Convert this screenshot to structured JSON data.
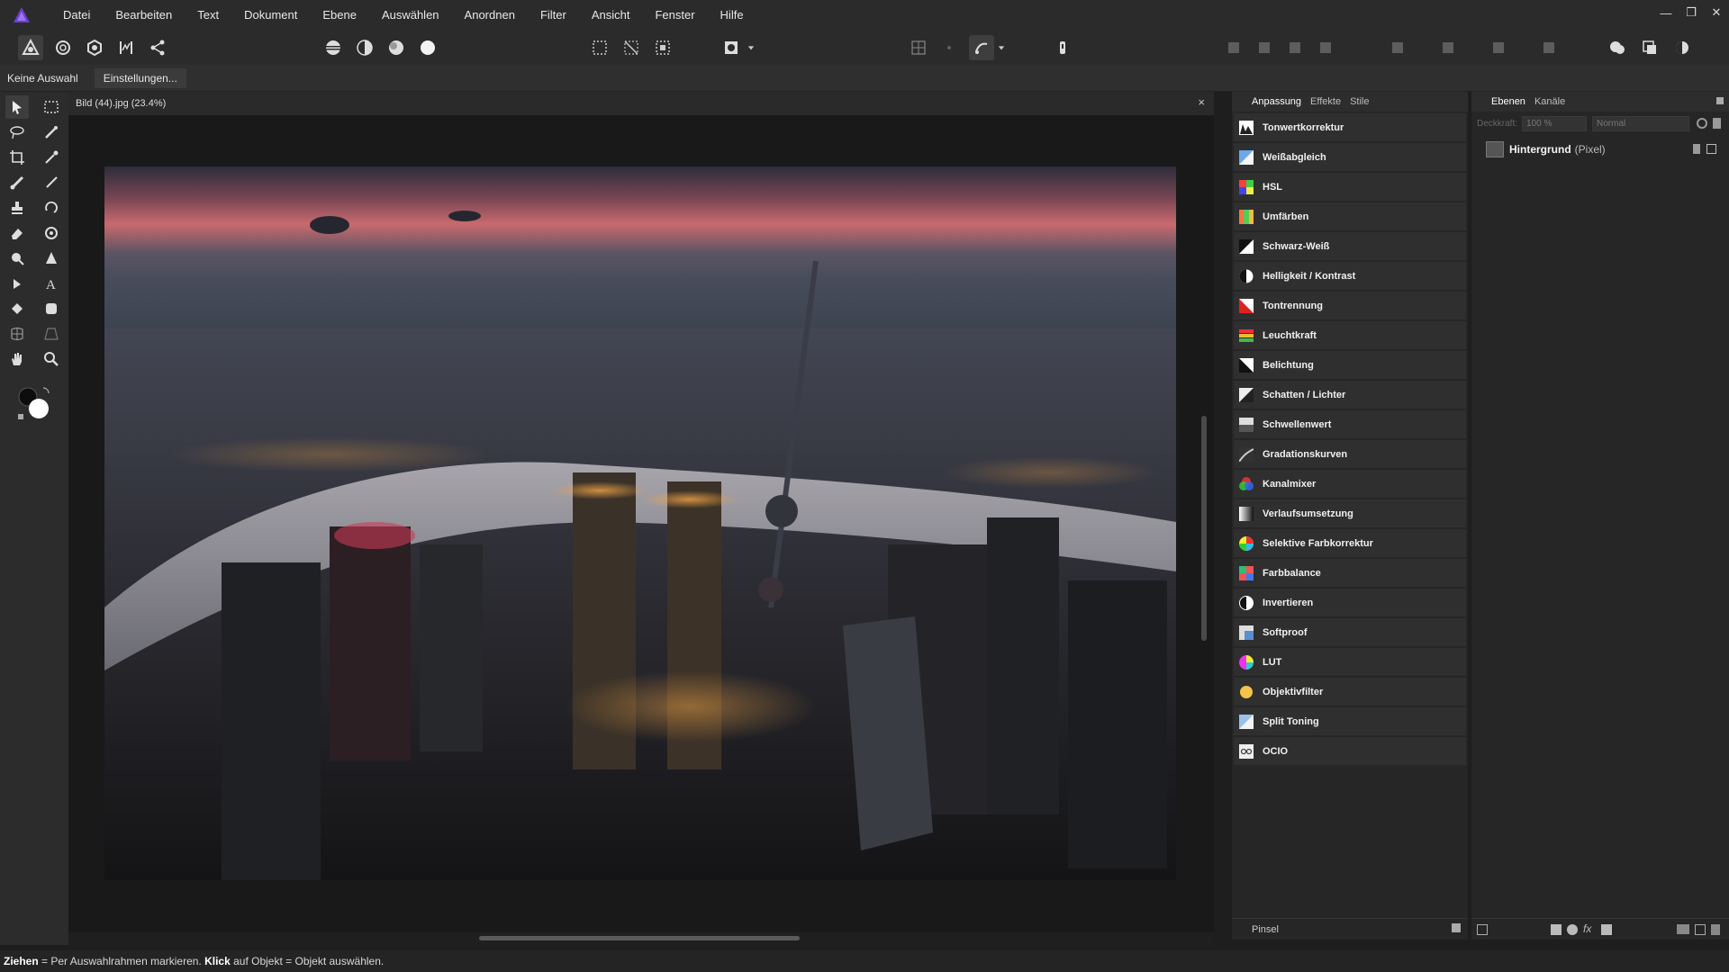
{
  "menu": {
    "items": [
      "Datei",
      "Bearbeiten",
      "Text",
      "Dokument",
      "Ebene",
      "Auswählen",
      "Anordnen",
      "Filter",
      "Ansicht",
      "Fenster",
      "Hilfe"
    ]
  },
  "context": {
    "selection_label": "Keine Auswahl",
    "settings_label": "Einstellungen..."
  },
  "document": {
    "title": "Bild (44).jpg (23.4%)",
    "close_symbol": "×"
  },
  "adjustments": {
    "tabs": [
      "Anpassung",
      "Effekte",
      "Stile"
    ],
    "items": [
      "Tonwertkorrektur",
      "Weißabgleich",
      "HSL",
      "Umfärben",
      "Schwarz-Weiß",
      "Helligkeit / Kontrast",
      "Tontrennung",
      "Leuchtkraft",
      "Belichtung",
      "Schatten / Lichter",
      "Schwellenwert",
      "Gradationskurven",
      "Kanalmixer",
      "Verlaufsumsetzung",
      "Selektive Farbkorrektur",
      "Farbbalance",
      "Invertieren",
      "Softproof",
      "LUT",
      "Objektivfilter",
      "Split Toning",
      "OCIO"
    ],
    "bottom_label": "Pinsel"
  },
  "layers": {
    "tabs": [
      "Ebenen",
      "Kanäle"
    ],
    "opacity_label": "Deckkraft:",
    "opacity_value": "100 %",
    "blend_mode": "Normal",
    "layer_name": "Hintergrund",
    "layer_type": "(Pixel)"
  },
  "status": {
    "key1": "Ziehen",
    "text1": " = Per Auswahlrahmen markieren. ",
    "key2": "Klick",
    "text2": " auf Objekt = Objekt auswählen."
  },
  "colors": {
    "accent": "#6b3fd4",
    "panel_bg": "#262626",
    "menubar_bg": "#2b2b2b"
  }
}
